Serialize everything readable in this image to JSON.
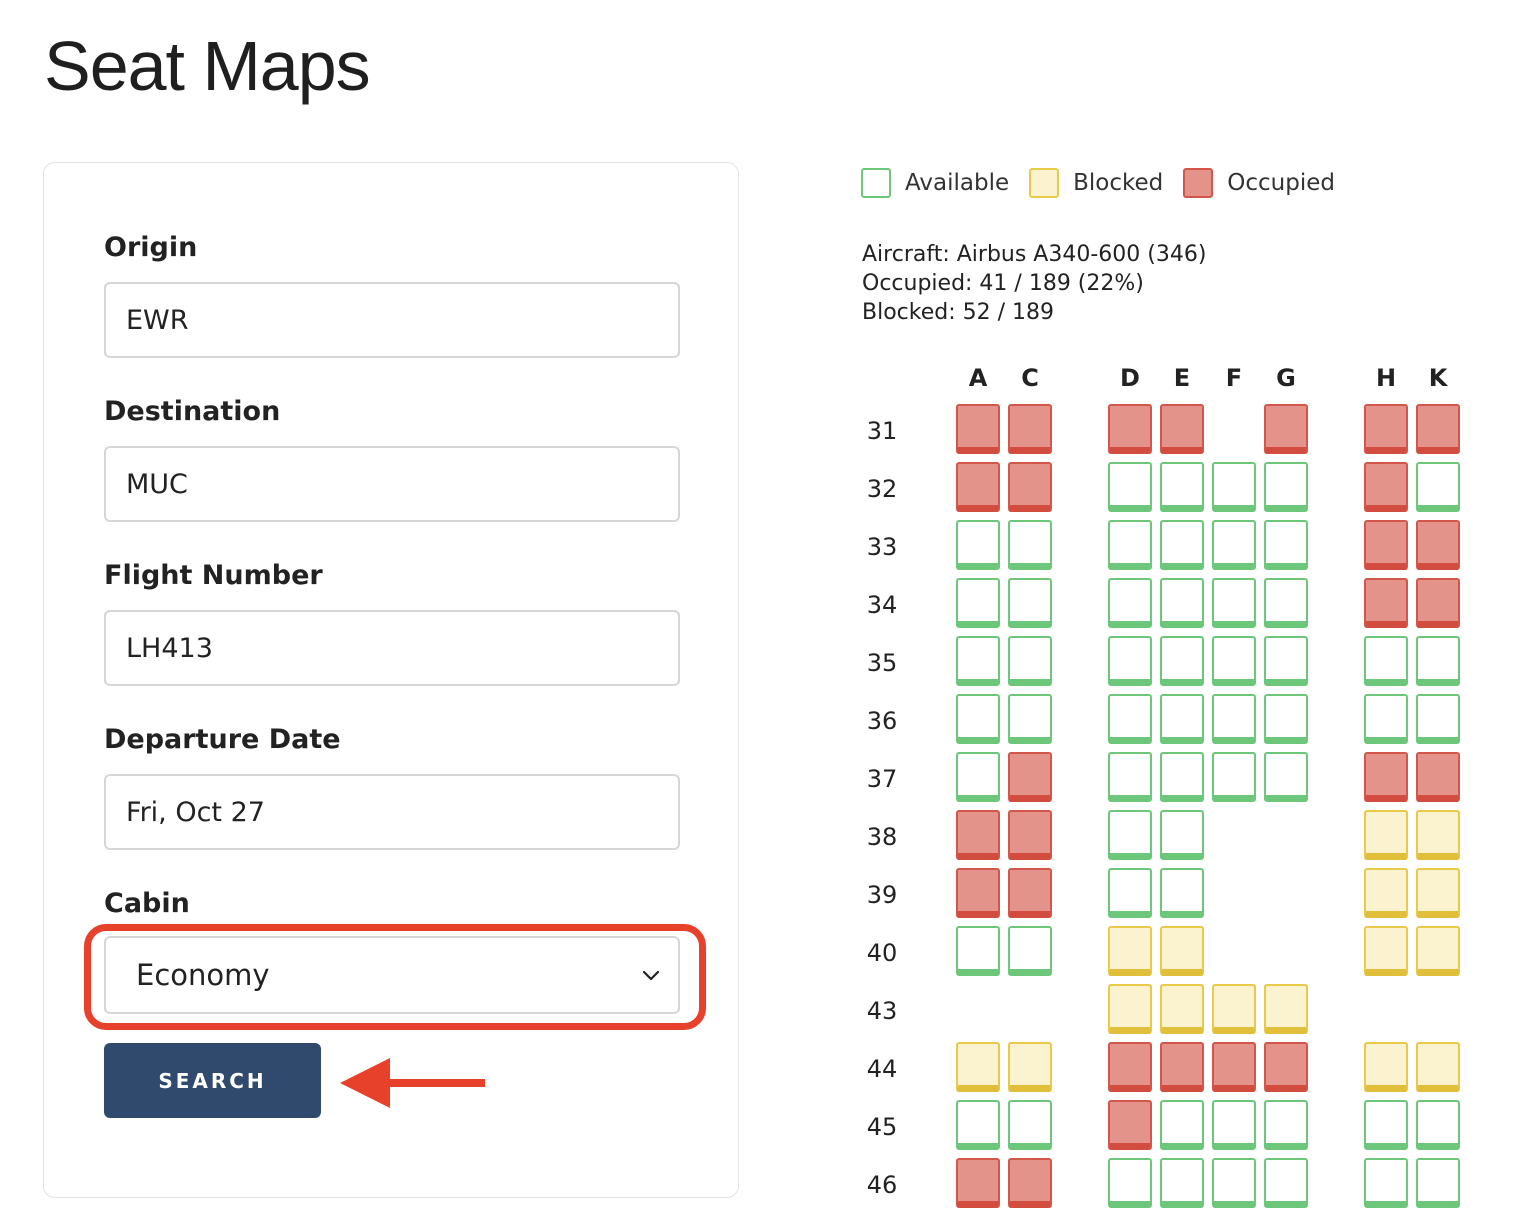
{
  "page": {
    "title": "Seat Maps"
  },
  "form": {
    "origin": {
      "label": "Origin",
      "value": "EWR"
    },
    "destination": {
      "label": "Destination",
      "value": "MUC"
    },
    "flight_number": {
      "label": "Flight Number",
      "value": "LH413"
    },
    "departure_date": {
      "label": "Departure Date",
      "value": "Fri, Oct 27"
    },
    "cabin": {
      "label": "Cabin",
      "value": "Economy"
    },
    "search_label": "SEARCH"
  },
  "legend": {
    "available": "Available",
    "blocked": "Blocked",
    "occupied": "Occupied"
  },
  "colors": {
    "available": "#6cc77a",
    "blocked": "#e9c94a",
    "occupied": "#d2574a",
    "button": "#2f4a6c",
    "highlight": "#e8412b"
  },
  "info": {
    "aircraft": "Aircraft: Airbus A340-600 (346)",
    "occupied": "Occupied: 41 / 189 (22%)",
    "blocked": "Blocked: 52 / 189"
  },
  "seat_map": {
    "columns": [
      "A",
      "C",
      "D",
      "E",
      "F",
      "G",
      "H",
      "K"
    ],
    "rows": [
      {
        "number": "31",
        "seats": [
          "O",
          "O",
          "O",
          "O",
          "-",
          "O",
          "O",
          "O"
        ]
      },
      {
        "number": "32",
        "seats": [
          "O",
          "O",
          "A",
          "A",
          "A",
          "A",
          "O",
          "A"
        ]
      },
      {
        "number": "33",
        "seats": [
          "A",
          "A",
          "A",
          "A",
          "A",
          "A",
          "O",
          "O"
        ]
      },
      {
        "number": "34",
        "seats": [
          "A",
          "A",
          "A",
          "A",
          "A",
          "A",
          "O",
          "O"
        ]
      },
      {
        "number": "35",
        "seats": [
          "A",
          "A",
          "A",
          "A",
          "A",
          "A",
          "A",
          "A"
        ]
      },
      {
        "number": "36",
        "seats": [
          "A",
          "A",
          "A",
          "A",
          "A",
          "A",
          "A",
          "A"
        ]
      },
      {
        "number": "37",
        "seats": [
          "A",
          "O",
          "A",
          "A",
          "A",
          "A",
          "O",
          "O"
        ]
      },
      {
        "number": "38",
        "seats": [
          "O",
          "O",
          "A",
          "A",
          "-",
          "-",
          "B",
          "B"
        ]
      },
      {
        "number": "39",
        "seats": [
          "O",
          "O",
          "A",
          "A",
          "-",
          "-",
          "B",
          "B"
        ]
      },
      {
        "number": "40",
        "seats": [
          "A",
          "A",
          "B",
          "B",
          "-",
          "-",
          "B",
          "B"
        ]
      },
      {
        "number": "43",
        "seats": [
          "-",
          "-",
          "B",
          "B",
          "B",
          "B",
          "-",
          "-"
        ]
      },
      {
        "number": "44",
        "seats": [
          "B",
          "B",
          "O",
          "O",
          "O",
          "O",
          "B",
          "B"
        ]
      },
      {
        "number": "45",
        "seats": [
          "A",
          "A",
          "O",
          "A",
          "A",
          "A",
          "A",
          "A"
        ]
      },
      {
        "number": "46",
        "seats": [
          "O",
          "O",
          "A",
          "A",
          "A",
          "A",
          "A",
          "A"
        ]
      }
    ]
  }
}
